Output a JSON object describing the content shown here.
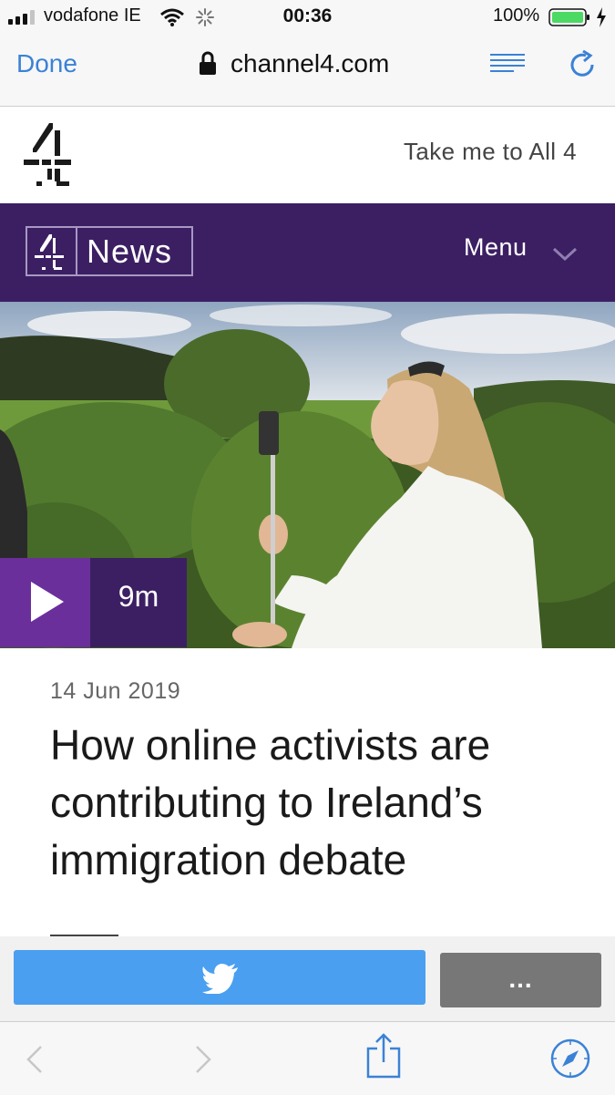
{
  "status_bar": {
    "carrier": "vodafone IE",
    "time": "00:36",
    "battery_percent": "100%",
    "signal_bars": 3,
    "battery_level": 1.0
  },
  "browser": {
    "done_label": "Done",
    "url": "channel4.com",
    "icons": [
      "lock-icon",
      "reader-icon",
      "reload-icon"
    ]
  },
  "header": {
    "logo": "channel4-logo",
    "take_me_link": "Take me to All 4"
  },
  "news_bar": {
    "section_label": "News",
    "menu_label": "Menu"
  },
  "hero": {
    "video_duration": "9m"
  },
  "article": {
    "date": "14 Jun 2019",
    "title": "How online activists are contributing to Ireland’s immigration debate"
  },
  "share": {
    "twitter_icon": "twitter-icon",
    "more_label": "..."
  },
  "colors": {
    "brand_purple": "#3c1f63",
    "play_purple": "#6b2f9c",
    "link_blue": "#3b82d6",
    "twitter_blue": "#4a9ff0"
  }
}
